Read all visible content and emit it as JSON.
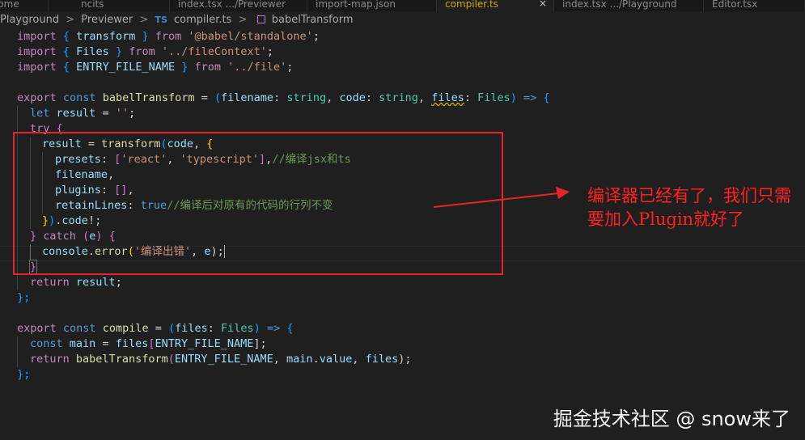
{
  "tabs": [
    {
      "label": "elcome"
    },
    {
      "label": "ncits"
    },
    {
      "label": "index.tsx .../Previewer"
    },
    {
      "label": "import-map.json"
    },
    {
      "label": "compiler.ts",
      "active": true,
      "close": "×"
    },
    {
      "label": "index.tsx .../Playground"
    },
    {
      "label": "Editor.tsx"
    }
  ],
  "breadcrumb": {
    "items": [
      "Playground",
      "Previewer",
      "compiler.ts",
      "babelTransform"
    ],
    "separator": ">",
    "ts_icon": "TS"
  },
  "code": {
    "l1": {
      "a": "import",
      "b": " { ",
      "c": "transform",
      "d": " } ",
      "e": "from",
      "f": " ",
      "g": "'@babel/standalone'",
      "h": ";"
    },
    "l2": {
      "a": "import",
      "b": " { ",
      "c": "Files",
      "d": " } ",
      "e": "from",
      "f": " ",
      "g": "'../fileContext'",
      "h": ";"
    },
    "l3": {
      "a": "import",
      "b": " { ",
      "c": "ENTRY_FILE_NAME",
      "d": " } ",
      "e": "from",
      "f": " ",
      "g": "'../file'",
      "h": ";"
    },
    "l5": {
      "a": "export",
      "b": " ",
      "c": "const",
      "d": " ",
      "e": "babelTransform",
      "f": " = ",
      "g": "(",
      "h": "filename",
      "i": ": ",
      "j": "string",
      "k": ", ",
      "l": "code",
      "m": ": ",
      "n": "string",
      "o": ", ",
      "p": "files",
      "q": ": ",
      "r": "Files",
      "s": ") ",
      "t": "=>",
      "u": " ",
      "w": "{"
    },
    "l6": {
      "a": "let",
      "b": " ",
      "c": "result",
      "d": " = ",
      "e": "''",
      "f": ";"
    },
    "l7": {
      "a": "try",
      "b": " ",
      "c": "{"
    },
    "l8": {
      "a": "result",
      "b": " = ",
      "c": "transform",
      "d": "(",
      "e": "code",
      "f": ", ",
      "g": "{"
    },
    "l9": {
      "a": "presets",
      "b": ": ",
      "c": "[",
      "d": "'react'",
      "e": ", ",
      "f": "'typescript'",
      "g": "]",
      "h": ",",
      "i": "//编译jsx和ts"
    },
    "l10": {
      "a": "filename",
      "b": ","
    },
    "l11": {
      "a": "plugins",
      "b": ": ",
      "c": "[]",
      "d": ","
    },
    "l12": {
      "a": "retainLines",
      "b": ": ",
      "c": "true",
      "d": "//编译后对原有的代码的行列不变"
    },
    "l13": {
      "a": "}",
      "b": ")",
      "c": ".",
      "d": "code",
      "e": "!;"
    },
    "l14": {
      "a": "}",
      "b": " ",
      "c": "catch",
      "d": " ",
      "e": "(",
      "f": "e",
      "g": ") ",
      "h": "{"
    },
    "l15": {
      "a": "console",
      "b": ".",
      "c": "error",
      "d": "(",
      "e": "'编译出错'",
      "f": ", ",
      "g": "e",
      "h": ");"
    },
    "l16": {
      "a": "}"
    },
    "l17": {
      "a": "return",
      "b": " ",
      "c": "result",
      "d": ";"
    },
    "l18": {
      "a": "};"
    },
    "l20": {
      "a": "export",
      "b": " ",
      "c": "const",
      "d": " ",
      "e": "compile",
      "f": " = ",
      "g": "(",
      "h": "files",
      "i": ": ",
      "j": "Files",
      "k": ") ",
      "l": "=>",
      "m": " ",
      "n": "{"
    },
    "l21": {
      "a": "const",
      "b": " ",
      "c": "main",
      "d": " = ",
      "e": "files",
      "f": "[",
      "g": "ENTRY_FILE_NAME",
      "h": "];"
    },
    "l22": {
      "a": "return",
      "b": " ",
      "c": "babelTransform",
      "d": "(",
      "e": "ENTRY_FILE_NAME",
      "f": ", ",
      "g": "main",
      "h": ".",
      "i": "value",
      "j": ", ",
      "k": "files",
      "l": ");"
    },
    "l23": {
      "a": "};"
    }
  },
  "annotation": "编译器已经有了，我们只需要加入Plugin就好了",
  "watermark": "掘金技术社区 @ snow来了",
  "colors": {
    "background": "#1f1f1f",
    "annotation": "#ff2020",
    "highlight_box": "#e8232a",
    "keyword": "#569cd6",
    "control": "#c586c0",
    "string": "#ce9178",
    "comment": "#6a9955"
  }
}
